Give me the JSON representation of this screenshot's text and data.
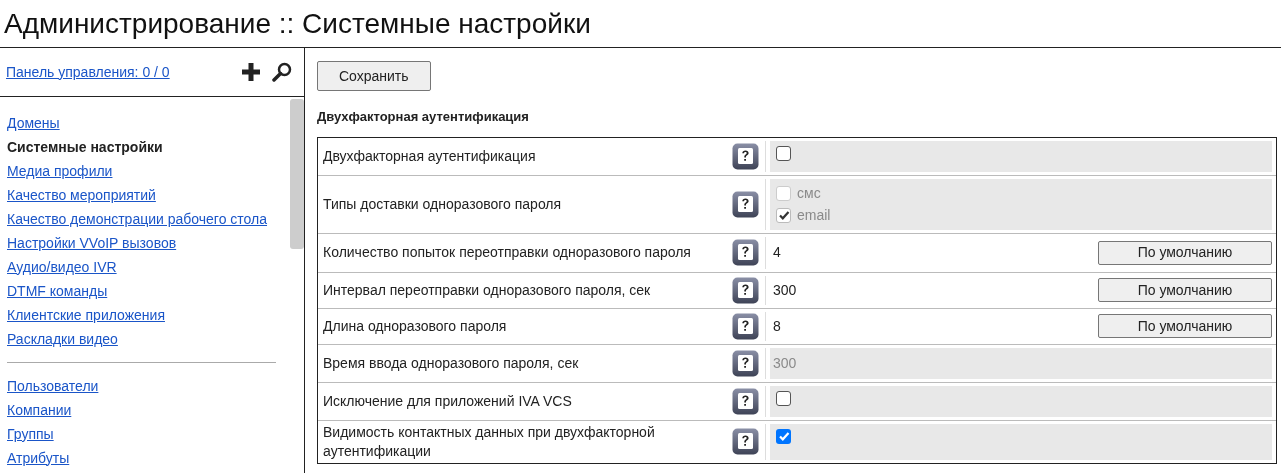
{
  "page": {
    "title": "Администрирование :: Системные настройки"
  },
  "sidebar": {
    "dashboard_link": "Панель управления: 0 / 0",
    "nav_groups": [
      {
        "items": [
          {
            "label": "Домены",
            "selected": false
          },
          {
            "label": "Системные настройки",
            "selected": true
          },
          {
            "label": "Медиа профили",
            "selected": false
          },
          {
            "label": "Качество мероприятий",
            "selected": false
          },
          {
            "label": "Качество демонстрации рабочего стола",
            "selected": false
          },
          {
            "label": "Настройки VVoIP вызовов",
            "selected": false
          },
          {
            "label": "Аудио/видео IVR",
            "selected": false
          },
          {
            "label": "DTMF команды",
            "selected": false
          },
          {
            "label": "Клиентские приложения",
            "selected": false
          },
          {
            "label": "Раскладки видео",
            "selected": false
          }
        ]
      },
      {
        "items": [
          {
            "label": "Пользователи",
            "selected": false
          },
          {
            "label": "Компании",
            "selected": false
          },
          {
            "label": "Группы",
            "selected": false
          },
          {
            "label": "Атрибуты",
            "selected": false
          }
        ]
      }
    ]
  },
  "toolbar": {
    "save_button": "Сохранить"
  },
  "section": {
    "title": "Двухфакторная аутентификация",
    "rows": [
      {
        "kind": "checkbox",
        "label": "Двухфакторная аутентификация",
        "checked": false
      },
      {
        "kind": "options",
        "label": "Типы доставки одноразового пароля",
        "disabled": true,
        "options": [
          {
            "label": "смс",
            "checked": false
          },
          {
            "label": "email",
            "checked": true
          }
        ]
      },
      {
        "kind": "number",
        "label": "Количество попыток переотправки одноразового пароля",
        "value": "4",
        "disabled": false,
        "default_button": "По умолчанию"
      },
      {
        "kind": "number",
        "label": "Интервал переотправки одноразового пароля, сек",
        "value": "300",
        "disabled": false,
        "default_button": "По умолчанию"
      },
      {
        "kind": "number",
        "label": "Длина одноразового пароля",
        "value": "8",
        "disabled": false,
        "default_button": "По умолчанию"
      },
      {
        "kind": "number",
        "label": "Время ввода одноразового пароля, сек",
        "value": "300",
        "disabled": true
      },
      {
        "kind": "checkbox",
        "label": "Исключение для приложений IVA VCS",
        "checked": false
      },
      {
        "kind": "checkbox",
        "label": "Видимость контактных данных при двухфакторной аутентификации",
        "checked": true
      }
    ]
  }
}
